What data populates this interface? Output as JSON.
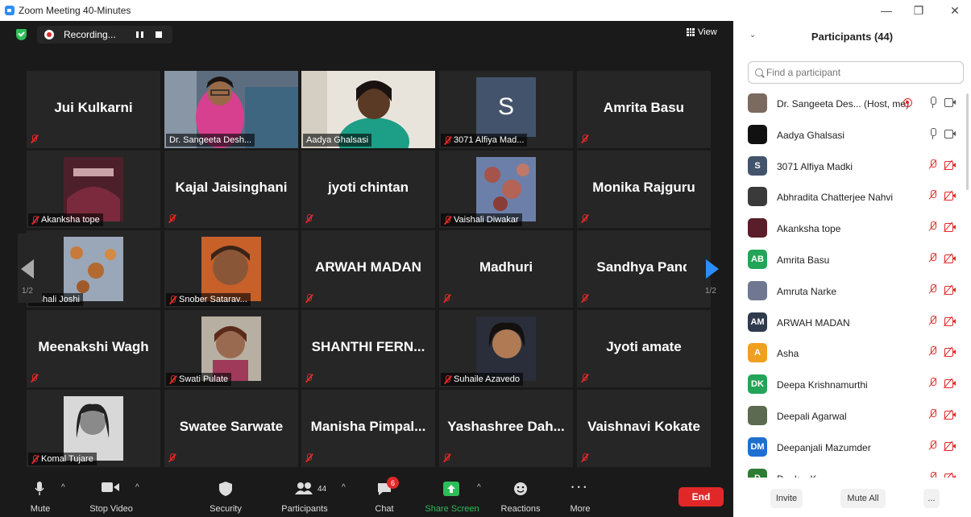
{
  "window": {
    "title": "Zoom Meeting 40-Minutes",
    "minimize": "—",
    "restore": "❐",
    "close": "✕"
  },
  "topbar": {
    "recording_label": "Recording...",
    "view_label": "View"
  },
  "tiles": {
    "t1": "Jui Kulkarni",
    "t2": "Dr. Sangeeta Desh...",
    "t3": "Aadya Ghalsasi",
    "t4": "3071 Alfiya Mad...",
    "t4_avatar": "S",
    "t5": "Amrita Basu",
    "t6": "Akanksha tope",
    "t7": "Kajal Jaisinghani",
    "t8": "jyoti chintan",
    "t9": "Vaishali Diwakar",
    "t10": "Monika Rajguru",
    "t11": "aishali Joshi",
    "t12": "Snober Satarav...",
    "t13": "ARWAH MADAN",
    "t14": "Madhuri",
    "t15": "Sandhya Pand",
    "t16": "Meenakshi Wagh",
    "t17": "Swati Pulate",
    "t18": "SHANTHI FERN...",
    "t19": "Suhaile Azavedo",
    "t20": "Jyoti amate",
    "t21": "Komal Tujare",
    "t22": "Swatee Sarwate",
    "t23": "Manisha Pimpal...",
    "t24": "Yashashree Dah...",
    "t25": "Vaishnavi Kokate"
  },
  "pagination": {
    "left": "1/2",
    "right": "1/2"
  },
  "toolbar": {
    "mute": "Mute",
    "stop_video": "Stop Video",
    "security": "Security",
    "participants": "Participants",
    "participants_count": "44",
    "chat": "Chat",
    "chat_badge": "6",
    "share_screen": "Share Screen",
    "reactions": "Reactions",
    "more": "More",
    "more_dots": "• • •",
    "end": "End",
    "caret": "^"
  },
  "panel": {
    "title": "Participants (44)",
    "search_placeholder": "Find a participant",
    "participants": [
      {
        "name": "Dr. Sangeeta Des... (Host, me)",
        "initials": "",
        "color": "#7a6a60",
        "mic": "on",
        "cam": "on",
        "recording": true
      },
      {
        "name": "Aadya Ghalsasi",
        "initials": "",
        "color": "#111111",
        "mic": "on",
        "cam": "on",
        "recording": false
      },
      {
        "name": "3071 Alfiya Madki",
        "initials": "S",
        "color": "#43536b",
        "mic": "off",
        "cam": "off",
        "recording": false
      },
      {
        "name": "Abhradita Chatterjee Nahvi",
        "initials": "",
        "color": "#3a3a3a",
        "mic": "off",
        "cam": "off",
        "recording": false
      },
      {
        "name": "Akanksha tope",
        "initials": "",
        "color": "#5a1d2a",
        "mic": "off",
        "cam": "off",
        "recording": false
      },
      {
        "name": "Amrita Basu",
        "initials": "AB",
        "color": "#23a559",
        "mic": "off",
        "cam": "off",
        "recording": false
      },
      {
        "name": "Amruta Narke",
        "initials": "",
        "color": "#6f7890",
        "mic": "off",
        "cam": "off",
        "recording": false
      },
      {
        "name": "ARWAH MADAN",
        "initials": "AM",
        "color": "#2f3a4d",
        "mic": "off",
        "cam": "off",
        "recording": false
      },
      {
        "name": "Asha",
        "initials": "A",
        "color": "#f0a020",
        "mic": "off",
        "cam": "off",
        "recording": false
      },
      {
        "name": "Deepa Krishnamurthi",
        "initials": "DK",
        "color": "#23a559",
        "mic": "off",
        "cam": "off",
        "recording": false
      },
      {
        "name": "Deepali Agarwal",
        "initials": "",
        "color": "#5b6a50",
        "mic": "off",
        "cam": "off",
        "recording": false
      },
      {
        "name": "Deepanjali Mazumder",
        "initials": "DM",
        "color": "#1e6fcf",
        "mic": "off",
        "cam": "off",
        "recording": false
      },
      {
        "name": "D... k... K...",
        "initials": "D",
        "color": "#2e7d32",
        "mic": "off",
        "cam": "off",
        "recording": false
      }
    ],
    "invite": "Invite",
    "mute_all": "Mute All",
    "more": "..."
  },
  "colors": {
    "accent": "#2d8cff",
    "danger": "#e02828",
    "success": "#2dbd59",
    "active_speaker": "#cfe86a"
  }
}
